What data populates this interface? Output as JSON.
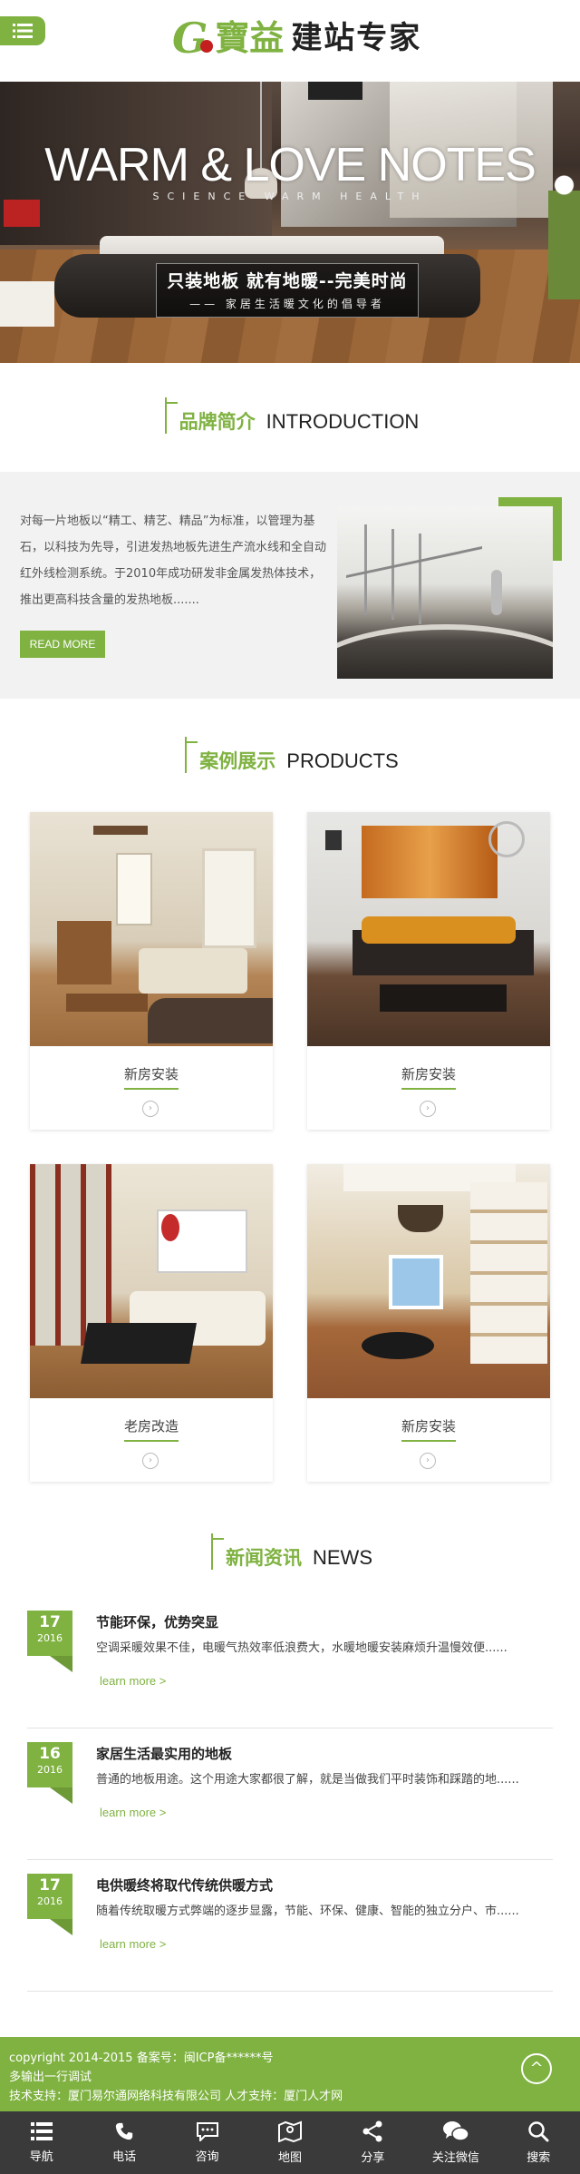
{
  "header": {
    "logo_g": "G",
    "logo_bao": "寶益",
    "logo_text": "建站专家",
    "menu_icon": "menu-icon"
  },
  "banner": {
    "title": "WARM & LOVE NOTES",
    "subtitle": "SCIENCE  WARM  HEALTH",
    "box_line1": "只装地板 就有地暖--完美时尚",
    "box_line2": "—— 家居生活暖文化的倡导者"
  },
  "intro": {
    "heading_cn": "品牌简介",
    "heading_en": "INTRODUCTION",
    "text": "对每一片地板以“精工、精艺、精品”为标准，以管理为基石，以科技为先导，引进发热地板先进生产流水线和全自动红外线检测系统。于2010年成功研发非金属发热体技术，推出更高科技含量的发热地板.......",
    "read_more": "READ MORE"
  },
  "products": {
    "heading_cn": "案例展示",
    "heading_en": "PRODUCTS",
    "items": [
      {
        "name": "新房安装"
      },
      {
        "name": "新房安装"
      },
      {
        "name": "老房改造"
      },
      {
        "name": "新房安装"
      }
    ],
    "arrow_glyph": "›"
  },
  "news": {
    "heading_cn": "新闻资讯",
    "heading_en": "NEWS",
    "items": [
      {
        "day": "17",
        "year": "2016",
        "title": "节能环保，优势突显",
        "desc": "空调采暖效果不佳，电暖气热效率低浪费大，水暖地暖安装麻烦升温慢效便......",
        "more": "learn more >"
      },
      {
        "day": "16",
        "year": "2016",
        "title": "家居生活最实用的地板",
        "desc": "普通的地板用途。这个用途大家都很了解，就是当做我们平时装饰和踩踏的地......",
        "more": "learn more >"
      },
      {
        "day": "17",
        "year": "2016",
        "title": "电供暖终将取代传统供暖方式",
        "desc": "随着传统取暖方式弊端的逐步显露，节能、环保、健康、智能的独立分户、市......",
        "more": "learn more >"
      }
    ]
  },
  "footer": {
    "line1": "copyright 2014-2015 备案号：闽ICP备******号",
    "line2": "多输出一行调试",
    "line3": "技术支持：厦门易尔通网络科技有限公司 人才支持：厦门人才网",
    "to_top": "^"
  },
  "bottom_nav": [
    {
      "label": "导航",
      "icon": "grid-menu-icon"
    },
    {
      "label": "电话",
      "icon": "phone-icon"
    },
    {
      "label": "咨询",
      "icon": "chat-icon"
    },
    {
      "label": "地图",
      "icon": "map-icon"
    },
    {
      "label": "分享",
      "icon": "share-icon"
    },
    {
      "label": "关注微信",
      "icon": "wechat-icon"
    },
    {
      "label": "搜索",
      "icon": "search-icon"
    }
  ],
  "colors": {
    "accent": "#7fb241",
    "footer_bg": "#7fb241",
    "nav_bg": "#3a3a3a"
  }
}
